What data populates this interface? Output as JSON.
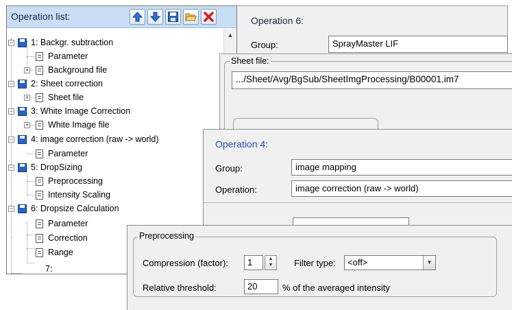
{
  "operation_list": {
    "title": "Operation list:",
    "toolbar": [
      {
        "name": "move-up-icon"
      },
      {
        "name": "move-down-icon"
      },
      {
        "name": "save-icon"
      },
      {
        "name": "open-folder-icon"
      },
      {
        "name": "delete-icon"
      }
    ],
    "tree": {
      "op1": "1: Backgr. subtraction",
      "op1_parameter": "Parameter",
      "op1_background_file": "Background file",
      "op2": "2: Sheet correction",
      "op2_sheet_file": "Sheet file",
      "op3": "3: White Image Correction",
      "op3_white_image_file": "White Image file",
      "op4": "4: image correction (raw -> world)",
      "op4_parameter": "Parameter",
      "op5": "5: DropSizing",
      "op5_preprocessing": "Preprocessing",
      "op5_intensity_scaling": "Intensity Scaling",
      "op6": "6: Dropsize Calculation",
      "op6_parameter": "Parameter",
      "op6_correction": "Correction",
      "op6_range": "Range",
      "op7": "7:"
    }
  },
  "operation6": {
    "title": "Operation 6:",
    "group_label": "Group:",
    "group_value": "SprayMaster LIF"
  },
  "sheet_file": {
    "legend": "Sheet file:",
    "path": ".../Sheet/Avg/BgSub/SheetImgProcessing/B00001.im7"
  },
  "operation4": {
    "title": "Operation 4:",
    "group_label": "Group:",
    "group_value": "image mapping",
    "operation_label": "Operation:",
    "operation_value": "image correction (raw -> world)"
  },
  "preprocessing": {
    "legend": "Preprocessing",
    "compression_label": "Compression (factor):",
    "compression_value": "1",
    "filter_type_label": "Filter type:",
    "filter_type_value": "<off>",
    "relative_threshold_label": "Relative threshold:",
    "relative_threshold_value": "20",
    "relative_threshold_unit": "% of the averaged intensity"
  },
  "colors": {
    "header_blue": "#c9def5",
    "title_blue": "#1b2c4a",
    "save_icon": "#2a64c2"
  }
}
